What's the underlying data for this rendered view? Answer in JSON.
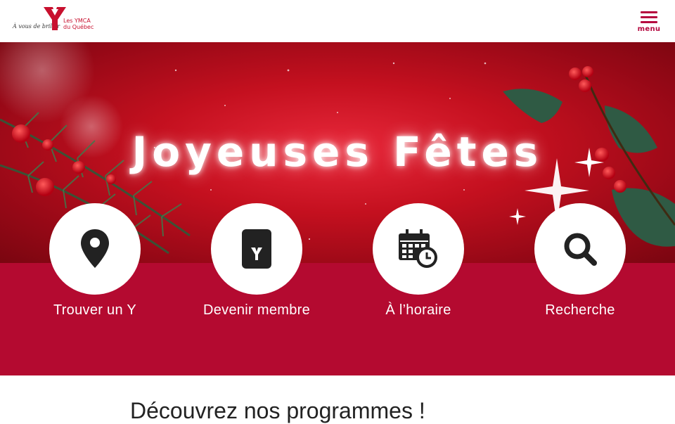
{
  "header": {
    "logo_tagline": "À vous de briller",
    "logo_brand_line1": "Les YMCA",
    "logo_brand_line2": "du Québec",
    "menu_label": "menu"
  },
  "hero": {
    "title": "Joyeuses Fêtes"
  },
  "quick_links": [
    {
      "label": "Trouver un Y",
      "icon": "map-pin-icon"
    },
    {
      "label": "Devenir membre",
      "icon": "membership-card-icon"
    },
    {
      "label": "À l’horaire",
      "icon": "calendar-clock-icon"
    },
    {
      "label": "Recherche",
      "icon": "search-icon"
    }
  ],
  "programs": {
    "title": "Découvrez nos programmes !"
  },
  "colors": {
    "brand_red": "#c8102e",
    "band_red": "#b40a30",
    "menu_red": "#b5083f",
    "icon_dark": "#222222"
  }
}
